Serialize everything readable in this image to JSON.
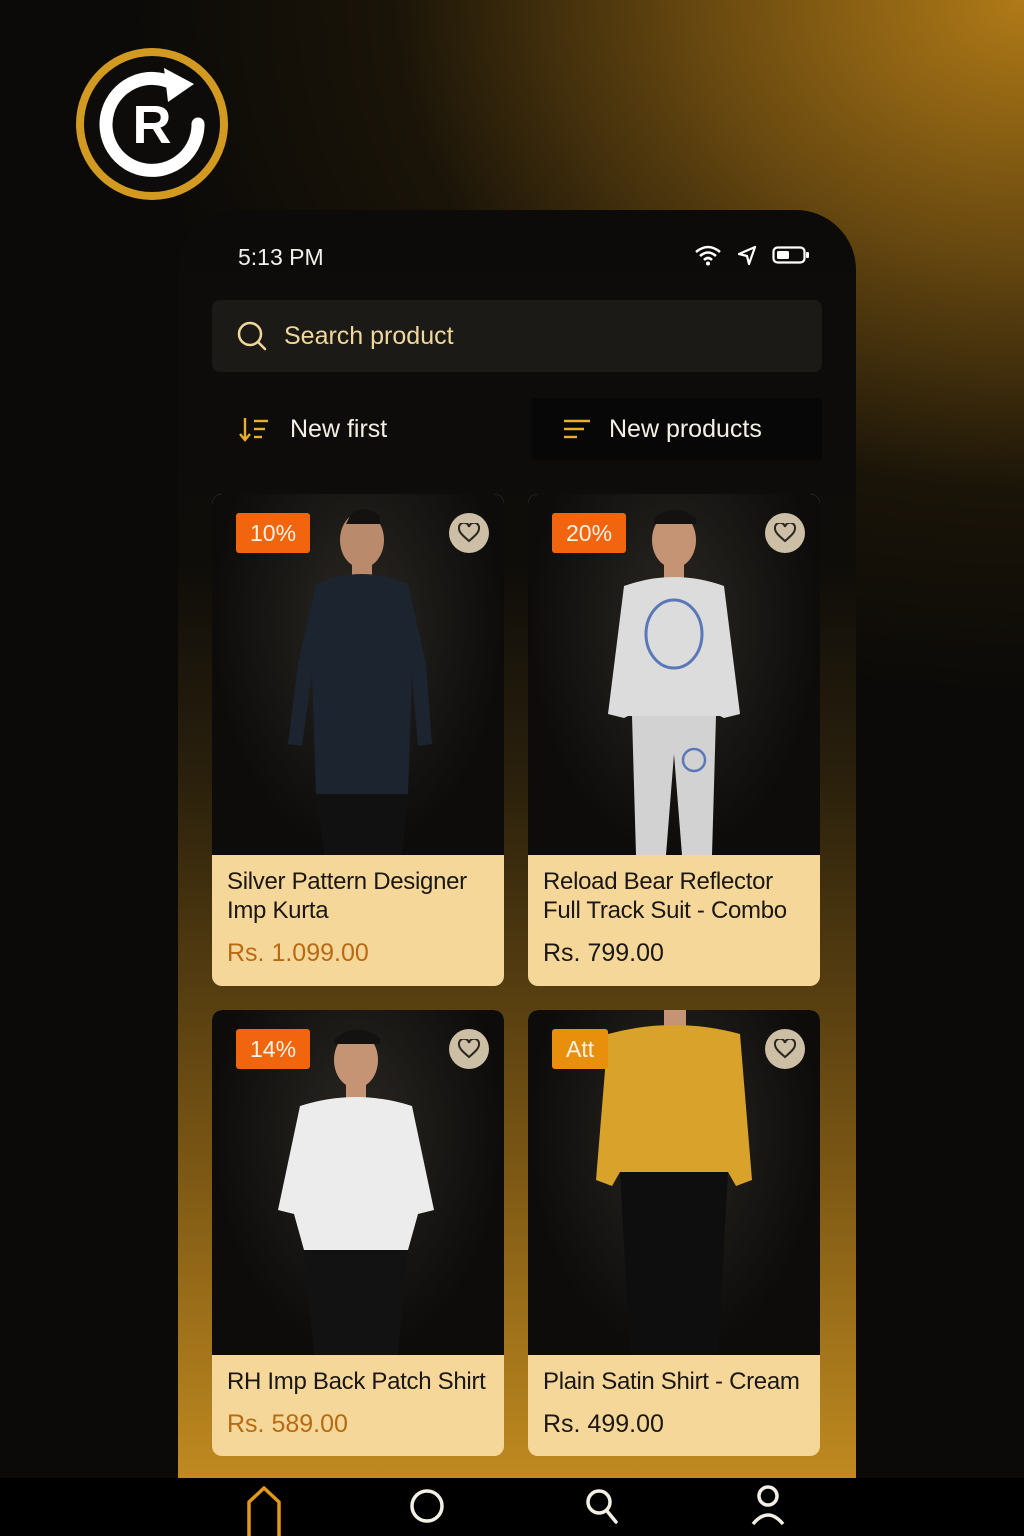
{
  "app": {
    "logo_icon": "brand-refresh-r-icon",
    "accent": "#d39a22"
  },
  "status_bar": {
    "time": "5:13 PM",
    "icons": [
      "wifi-icon",
      "location-arrow-icon",
      "battery-icon"
    ]
  },
  "search": {
    "placeholder": "Search product",
    "value": ""
  },
  "toolbar": {
    "sort_label": "New first",
    "filter_label": "New products"
  },
  "products": [
    {
      "badge": "10%",
      "name": "Silver Pattern Designer Imp Kurta",
      "price": "Rs. 1.099.00",
      "price_color": "#b86a12",
      "image": "man in dark kurta"
    },
    {
      "badge": "20%",
      "name": "Reload Bear Reflector Full Track Suit - Combo",
      "price": "Rs. 799.00",
      "price_color": "#1a1714",
      "image": "man in grey track suit"
    },
    {
      "badge": "14%",
      "name": "RH Imp Back Patch Shirt",
      "price": "Rs. 589.00",
      "price_color": "#b86a12",
      "image": "man in white shirt"
    },
    {
      "badge": "Att",
      "name": "Plain Satin Shirt - Cream",
      "price": "Rs. 499.00",
      "price_color": "#1a1714",
      "image": "man in mustard satin shirt"
    }
  ],
  "bottom_nav": {
    "items": [
      "home-icon",
      "circle-icon",
      "search-icon",
      "profile-icon"
    ]
  }
}
